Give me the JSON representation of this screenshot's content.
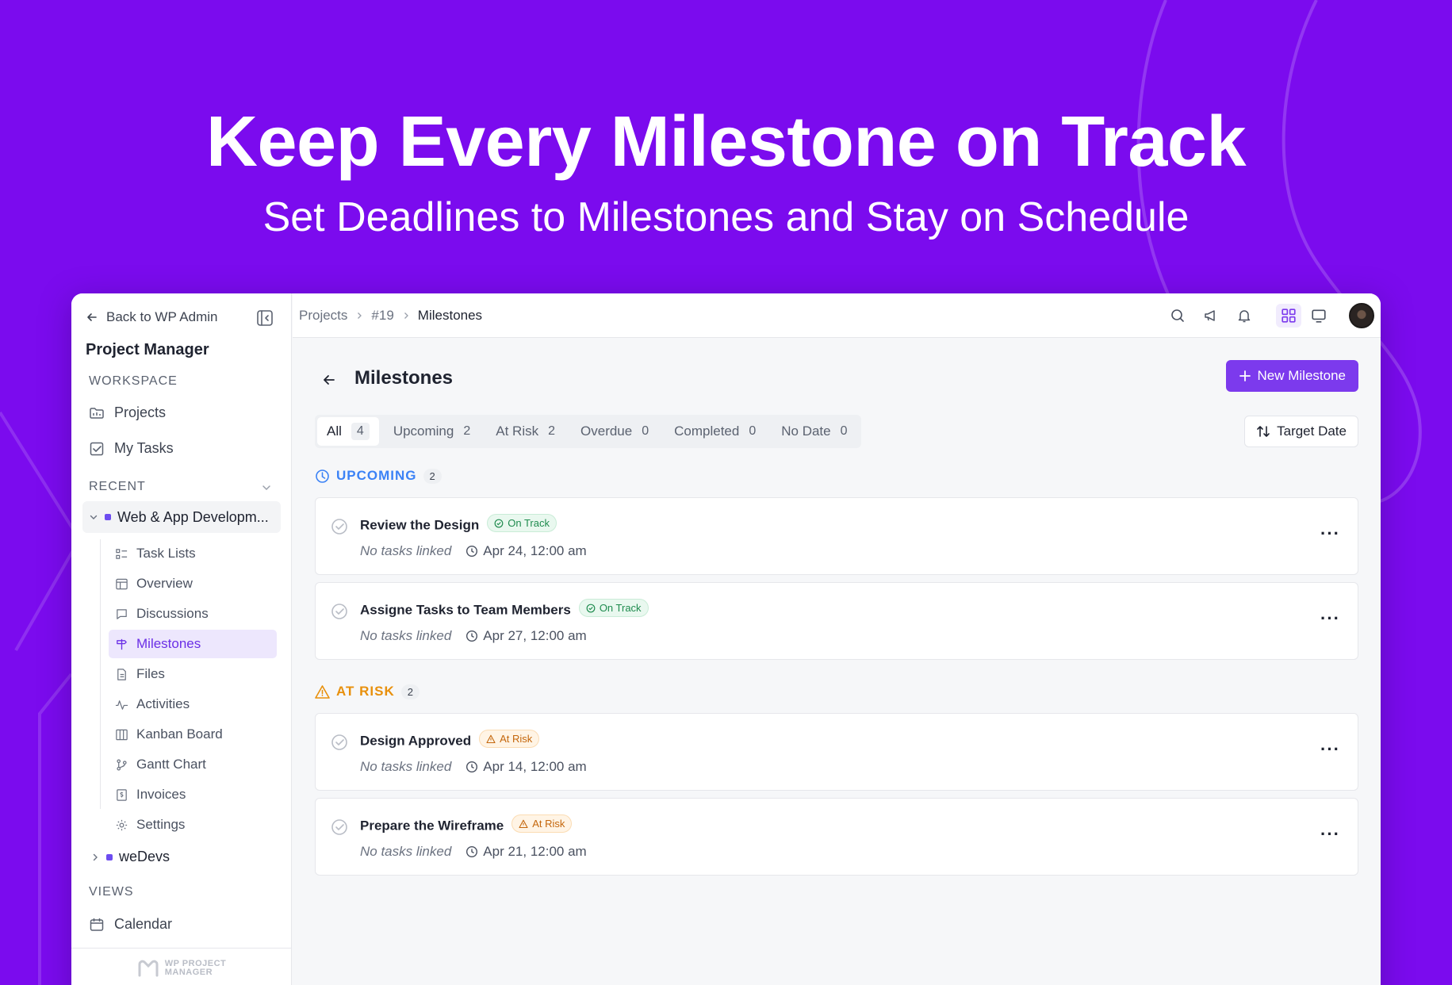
{
  "hero": {
    "title": "Keep Every Milestone on Track",
    "subtitle": "Set Deadlines to Milestones and Stay on Schedule"
  },
  "colors": {
    "background": "#7b0bee",
    "accent": "#7c3aed",
    "on_track": "#1f8b4e",
    "at_risk": "#c4660b",
    "upcoming": "#3b82f6"
  },
  "sidebar": {
    "back_label": "Back to WP Admin",
    "app_title": "Project Manager",
    "workspace_label": "WORKSPACE",
    "workspace_items": [
      {
        "label": "Projects",
        "icon": "folder-icon"
      },
      {
        "label": "My Tasks",
        "icon": "checkbox-icon"
      }
    ],
    "recent_label": "RECENT",
    "project_name": "Web & App Developm...",
    "project_items": [
      {
        "label": "Task Lists",
        "icon": "task-list-icon"
      },
      {
        "label": "Overview",
        "icon": "overview-icon"
      },
      {
        "label": "Discussions",
        "icon": "chat-icon"
      },
      {
        "label": "Milestones",
        "icon": "signpost-icon",
        "active": true
      },
      {
        "label": "Files",
        "icon": "file-icon"
      },
      {
        "label": "Activities",
        "icon": "activity-icon"
      },
      {
        "label": "Kanban Board",
        "icon": "kanban-icon"
      },
      {
        "label": "Gantt Chart",
        "icon": "gantt-icon"
      },
      {
        "label": "Invoices",
        "icon": "invoice-icon"
      },
      {
        "label": "Settings",
        "icon": "gear-icon"
      }
    ],
    "other_project": "weDevs",
    "views_label": "VIEWS",
    "views_items": [
      {
        "label": "Calendar",
        "icon": "calendar-icon"
      }
    ],
    "footer_logo_line1": "WP PROJECT",
    "footer_logo_line2": "MANAGER"
  },
  "topbar": {
    "breadcrumb": [
      "Projects",
      "#19",
      "Milestones"
    ]
  },
  "main": {
    "title": "Milestones",
    "new_button": "New Milestone",
    "sort_button": "Target Date",
    "filters": [
      {
        "label": "All",
        "count": "4",
        "active": true
      },
      {
        "label": "Upcoming",
        "count": "2"
      },
      {
        "label": "At Risk",
        "count": "2"
      },
      {
        "label": "Overdue",
        "count": "0"
      },
      {
        "label": "Completed",
        "count": "0"
      },
      {
        "label": "No Date",
        "count": "0"
      }
    ],
    "groups": [
      {
        "label": "UPCOMING",
        "count": "2",
        "kind": "upcoming",
        "items": [
          {
            "title": "Review the Design",
            "status": "On Track",
            "tasks": "No tasks linked",
            "date": "Apr 24, 12:00 am"
          },
          {
            "title": "Assigne Tasks to Team Members",
            "status": "On Track",
            "tasks": "No tasks linked",
            "date": "Apr 27, 12:00 am"
          }
        ]
      },
      {
        "label": "AT RISK",
        "count": "2",
        "kind": "risk",
        "items": [
          {
            "title": "Design Approved",
            "status": "At Risk",
            "tasks": "No tasks linked",
            "date": "Apr 14, 12:00 am"
          },
          {
            "title": "Prepare the Wireframe",
            "status": "At Risk",
            "tasks": "No tasks linked",
            "date": "Apr 21, 12:00 am"
          }
        ]
      }
    ]
  }
}
